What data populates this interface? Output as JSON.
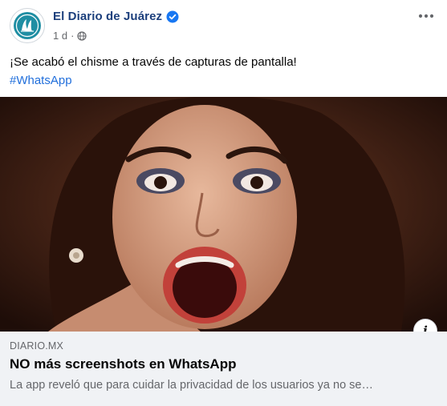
{
  "post": {
    "page_name": "El Diario de Juárez",
    "verified_icon": "verified-badge-icon",
    "time": "1 d",
    "separator": "·",
    "audience_icon": "globe-icon",
    "more_icon": "more-options-icon"
  },
  "caption": {
    "text": "¡Se acabó el chisme a través de capturas de pantalla!",
    "hashtag": "#WhatsApp"
  },
  "link_preview": {
    "domain": "DIARIO.MX",
    "title": "NO más screenshots en WhatsApp",
    "description": "La app reveló que para cuidar la privacidad de los usuarios ya no se…",
    "info_label": "i"
  },
  "colors": {
    "page_name": "#1c3f7c",
    "verified": "#1877f2",
    "hashtag": "#216fdb",
    "link_box_bg": "#f0f2f5",
    "secondary_text": "#65676b"
  }
}
